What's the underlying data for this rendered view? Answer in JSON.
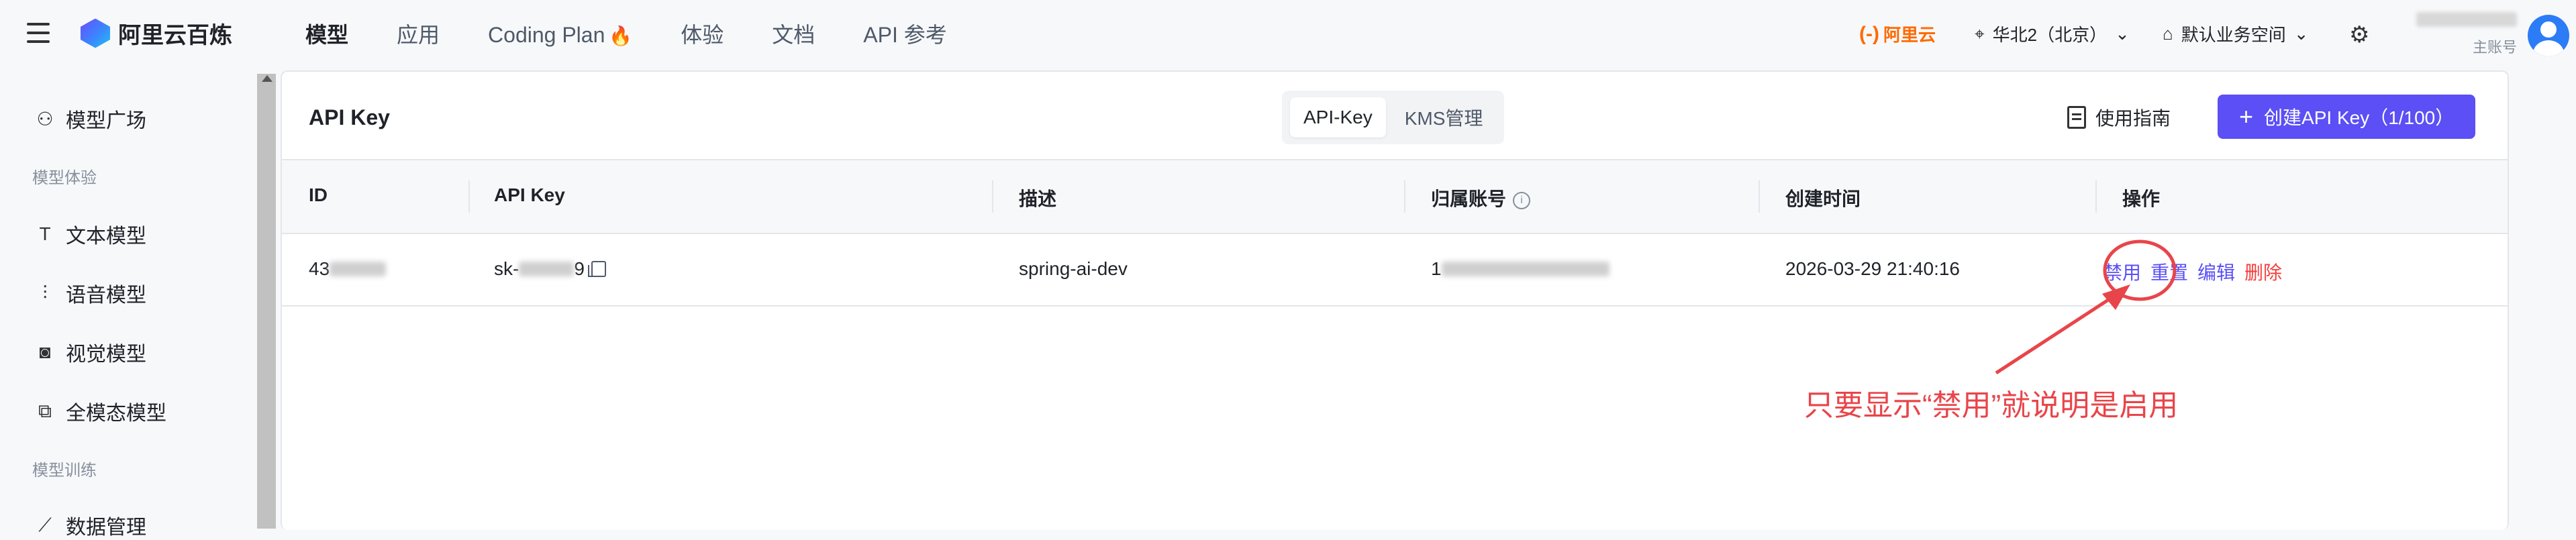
{
  "topbar": {
    "brand": "阿里云百炼",
    "nav": [
      "模型",
      "应用",
      "Coding Plan",
      "体验",
      "文档",
      "API 参考"
    ],
    "aliyun": "阿里云",
    "region": "华北2（北京）",
    "workspace": "默认业务空间",
    "account_sub": "主账号"
  },
  "sidebar": {
    "items": [
      {
        "label": "模型广场",
        "icon": "model-square-icon"
      },
      {
        "group": "模型体验"
      },
      {
        "label": "文本模型",
        "icon": "text-icon"
      },
      {
        "label": "语音模型",
        "icon": "audio-icon"
      },
      {
        "label": "视觉模型",
        "icon": "camera-icon"
      },
      {
        "label": "全模态模型",
        "icon": "multimodal-icon"
      },
      {
        "group": "模型训练"
      },
      {
        "label": "数据管理",
        "icon": "chart-icon"
      }
    ]
  },
  "panel": {
    "title": "API Key",
    "tabs": [
      "API-Key",
      "KMS管理"
    ],
    "guide": "使用指南",
    "create_button": "创建API Key（1/100）"
  },
  "table": {
    "columns": [
      "ID",
      "API Key",
      "描述",
      "归属账号",
      "创建时间",
      "操作"
    ],
    "rows": [
      {
        "id_prefix": "43",
        "key_prefix": "sk-",
        "key_suffix": "9",
        "description": "spring-ai-dev",
        "account_prefix": "1",
        "created": "2026-03-29 21:40:16",
        "actions": [
          "禁用",
          "重置",
          "编辑",
          "删除"
        ]
      }
    ]
  },
  "annotation": {
    "text": "只要显示“禁用”就说明是启用"
  },
  "colors": {
    "primary": "#5b4ff5",
    "danger": "#f53f3f",
    "annotation": "#e8454a",
    "aliyun": "#ff6a00"
  }
}
